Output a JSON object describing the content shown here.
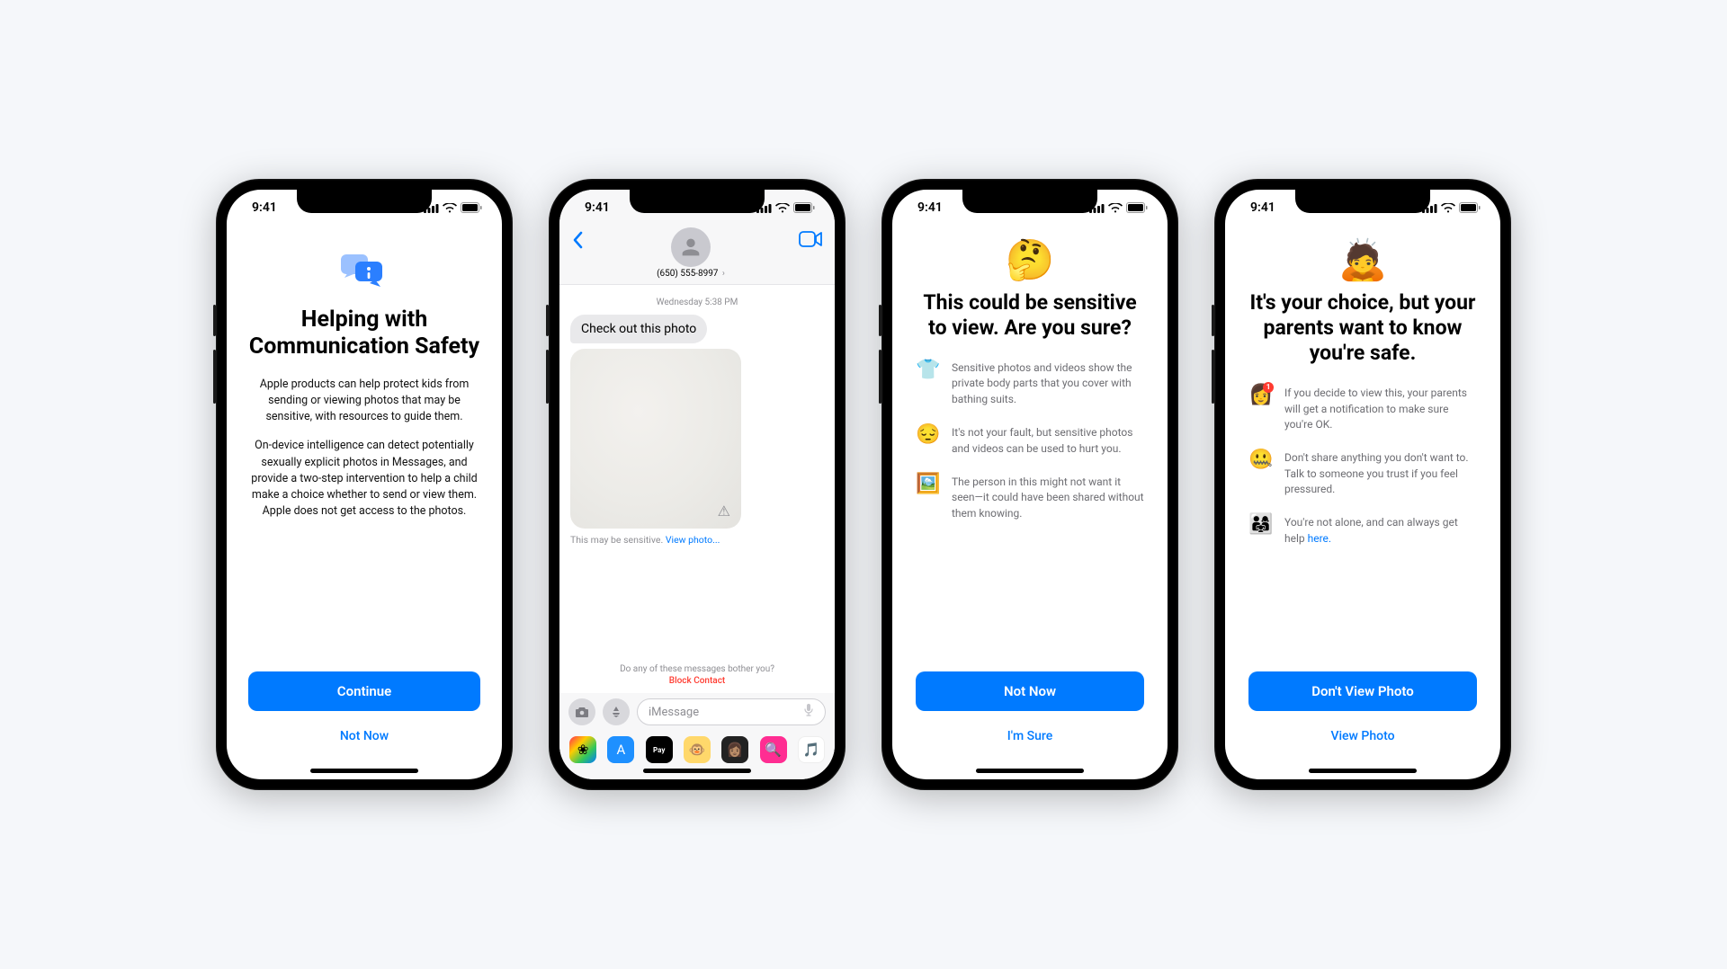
{
  "status": {
    "time": "9:41"
  },
  "phone1": {
    "title": "Helping with Communication Safety",
    "para1": "Apple products can help protect kids from sending or viewing photos that may be sensitive, with resources to guide them.",
    "para2": "On-device intelligence can detect potentially sexually explicit photos in Messages, and provide a two-step intervention to help a child make a choice whether to send or view them. Apple does not get access to the photos.",
    "primary": "Continue",
    "secondary": "Not Now"
  },
  "phone2": {
    "contact": "(650) 555-8997",
    "timestamp": "Wednesday 5:38 PM",
    "incoming": "Check out this photo",
    "sensitive_prefix": "This may be sensitive. ",
    "sensitive_link": "View photo...",
    "bother_question": "Do any of these messages bother you?",
    "block_contact": "Block Contact",
    "placeholder": "iMessage"
  },
  "phone3": {
    "emoji": "🤔",
    "title": "This could be sensitive to view. Are you sure?",
    "items": [
      {
        "emoji": "👕",
        "text": "Sensitive photos and videos show the private body parts that you cover with bathing suits."
      },
      {
        "emoji": "😔",
        "text": "It's not your fault, but sensitive photos and videos can be used to hurt you."
      },
      {
        "emoji": "🖼️",
        "text": "The person in this might not want it seen—it could have been shared without them knowing."
      }
    ],
    "primary": "Not Now",
    "secondary": "I'm Sure"
  },
  "phone4": {
    "emoji": "🙇",
    "title": "It's your choice, but your parents want to know you're safe.",
    "items": [
      {
        "emoji": "👩",
        "badge": "1",
        "text": "If you decide to view this, your parents will get a notification to make sure you're OK."
      },
      {
        "emoji": "🤐",
        "text": "Don't share anything you don't want to. Talk to someone you trust if you feel pressured."
      },
      {
        "emoji": "👨‍👩‍👧",
        "text": "You're not alone, and can always get help ",
        "link": "here."
      }
    ],
    "primary": "Don't View Photo",
    "secondary": "View Photo"
  }
}
